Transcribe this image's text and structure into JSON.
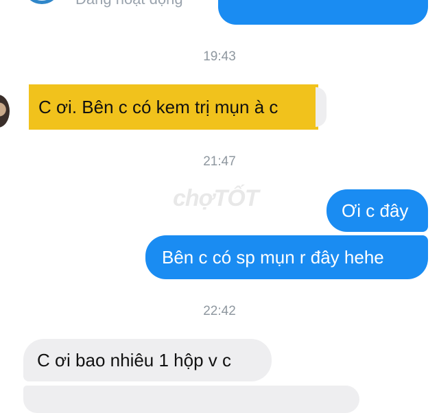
{
  "header": {
    "status_text": "Đang hoạt động"
  },
  "messages": [
    {
      "type": "timestamp",
      "text": "19:43"
    },
    {
      "type": "incoming-highlighted",
      "text": "C ơi. Bên c có kem trị mụn à c"
    },
    {
      "type": "timestamp",
      "text": "21:47"
    },
    {
      "type": "outgoing",
      "text": "Ơi c đây"
    },
    {
      "type": "outgoing",
      "text": "Bên c có sp mụn r đây hehe"
    },
    {
      "type": "timestamp",
      "text": "22:42"
    },
    {
      "type": "incoming",
      "text": "C ơi bao nhiêu 1 hộp v c"
    }
  ],
  "watermark": "chợTỐT",
  "colors": {
    "outgoing_bubble": "#1a8cf2",
    "incoming_bubble": "#eeeef0",
    "highlight": "#f1c21c",
    "timestamp_text": "#8e979f"
  }
}
